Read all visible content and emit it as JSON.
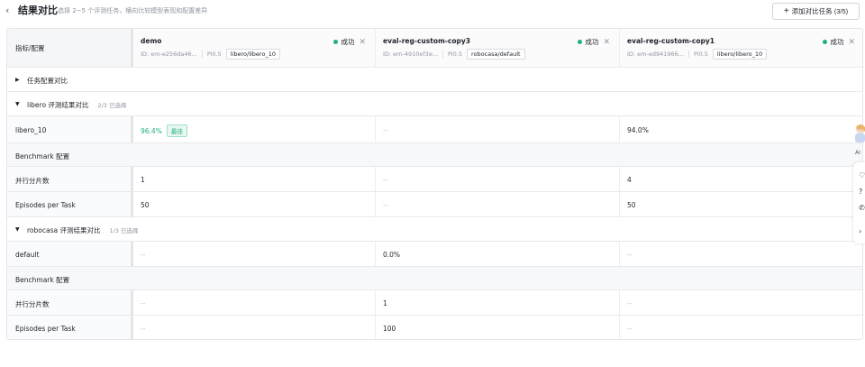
{
  "header": {
    "back_icon": "chevron-left-icon",
    "title": "结果对比",
    "subtitle": "选择 2~5 个评测任务，横向比较模型表现和配置差异",
    "add_button": "添加对比任务 (3/5)"
  },
  "table": {
    "corner_label": "指标/配置",
    "tasks": [
      {
        "name": "demo",
        "status": "成功",
        "id": "ID: em-e256da46...",
        "model": "Pi0.5",
        "dataset": "libero/libero_10"
      },
      {
        "name": "eval-reg-custom-copy3",
        "status": "成功",
        "id": "ID: em-4910ef3e...",
        "model": "Pi0.5",
        "dataset": "robocasa/default"
      },
      {
        "name": "eval-reg-custom-copy1",
        "status": "成功",
        "id": "ID: em-ed941966...",
        "model": "Pi0.5",
        "dataset": "libero/libero_10"
      }
    ],
    "status_color": "#22b07d",
    "sections": {
      "task_config": "任务配置对比",
      "libero": {
        "title": "libero 评测结果对比",
        "count": "2/3 已选择"
      },
      "robocasa": {
        "title": "robocasa 评测结果对比",
        "count": "1/3 已选择"
      }
    },
    "libero_rows": {
      "metric": {
        "label": "libero_10",
        "v1": "96.4%",
        "best": "最佳",
        "v2": "--",
        "v3": "94.0%"
      },
      "bench": "Benchmark 配置",
      "parallel": {
        "label": "并行分片数",
        "v1": "1",
        "v2": "--",
        "v3": "4"
      },
      "episodes": {
        "label": "Episodes per Task",
        "v1": "50",
        "v2": "--",
        "v3": "50"
      }
    },
    "robocasa_rows": {
      "metric": {
        "label": "default",
        "v1": "--",
        "v2": "0.0%",
        "v3": "--"
      },
      "bench": "Benchmark 配置",
      "parallel": {
        "label": "并行分片数",
        "v1": "--",
        "v2": "1",
        "v3": "--"
      },
      "episodes": {
        "label": "Episodes per Task",
        "v1": "--",
        "v2": "100",
        "v3": "--"
      }
    }
  },
  "floating": {
    "label": "AI"
  }
}
